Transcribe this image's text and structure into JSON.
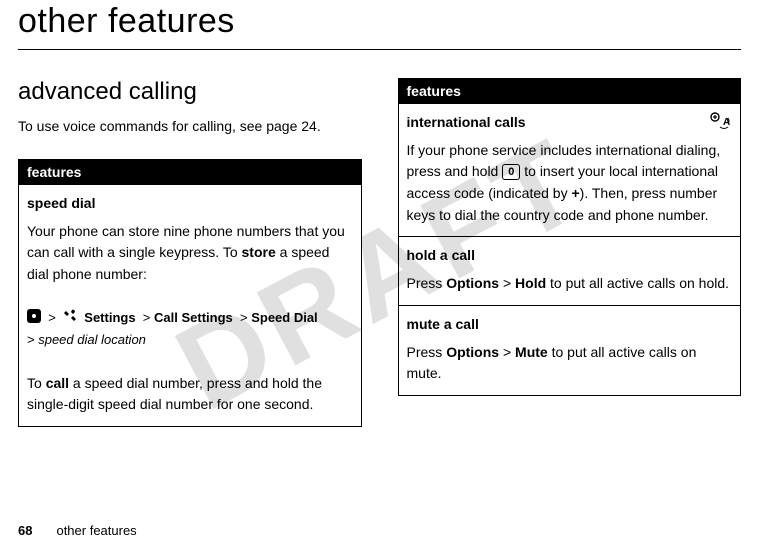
{
  "watermark": "DRAFT",
  "page_title": "other features",
  "section_title": "advanced calling",
  "intro_text": "To use voice commands for calling, see page 24.",
  "left_table": {
    "header": "features",
    "speed_dial": {
      "title": "speed dial",
      "body1_a": "Your phone can store nine phone numbers that you can call with a single keypress. To ",
      "body1_bold": "store",
      "body1_b": " a speed dial phone number:",
      "path_settings": "Settings",
      "path_call": "Call Settings",
      "path_speed": "Speed Dial",
      "path_location": "speed dial location",
      "body2_a": "To ",
      "body2_bold": "call",
      "body2_b": " a speed dial number, press and hold the single-digit speed dial number for one second."
    }
  },
  "right_table": {
    "header": "features",
    "intl": {
      "title": "international calls",
      "body_a": "If your phone service includes international dialing, press and hold ",
      "key_label": "0",
      "body_b": " to insert your local international access code (indicated by ",
      "plus": "+",
      "body_c": "). Then, press number keys to dial the country code and phone number."
    },
    "hold": {
      "title": "hold a call",
      "body_a": "Press ",
      "opt": "Options",
      "gt": " > ",
      "hold": "Hold",
      "body_b": " to put all active calls on hold."
    },
    "mute": {
      "title": "mute a call",
      "body_a": "Press ",
      "opt": "Options",
      "gt": " > ",
      "mute": "Mute",
      "body_b": " to put all active calls on mute."
    }
  },
  "footer": {
    "page_number": "68",
    "label": "other features"
  }
}
